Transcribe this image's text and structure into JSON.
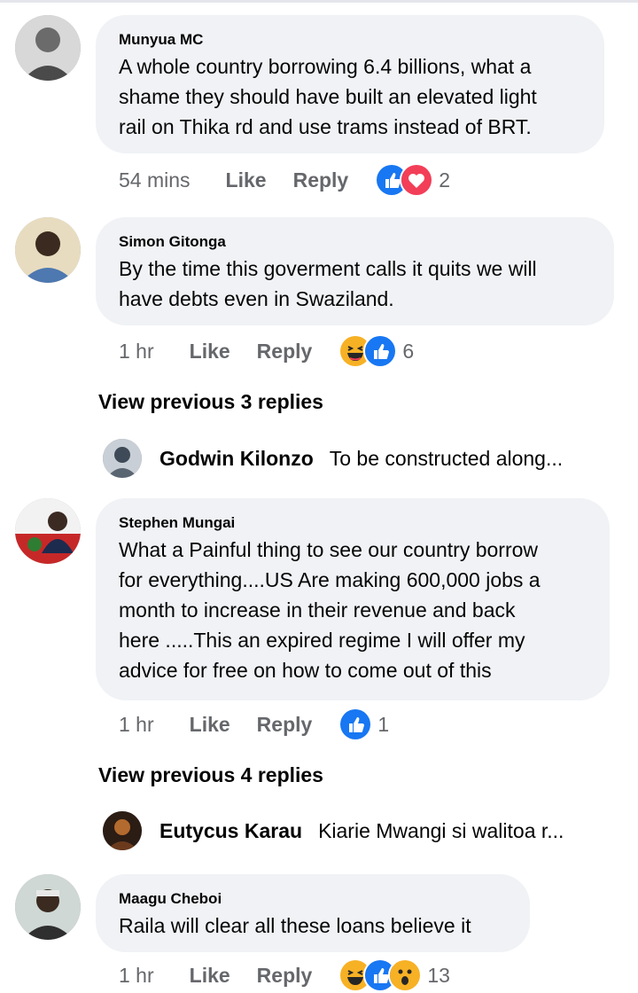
{
  "comments": [
    {
      "author": "Munyua MC",
      "text": "A whole country borrowing 6.4 billions, what a\nshame they should have built an elevated light\nrail on Thika rd and use trams instead of BRT.",
      "time": "54 mins",
      "like": "Like",
      "reply": "Reply",
      "reactions": [
        "like-icon",
        "love-icon"
      ],
      "reaction_count": "2"
    },
    {
      "author": "Simon Gitonga",
      "text": "By the time this goverment calls it quits we will\nhave debts even in Swaziland.",
      "time": "1 hr",
      "like": "Like",
      "reply": "Reply",
      "reactions": [
        "haha-icon",
        "like-icon"
      ],
      "reaction_count": "6"
    },
    {
      "author": "Stephen Mungai",
      "text": "What a Painful thing to see our country borrow\nfor everything....US Are making 600,000 jobs a\nmonth to increase in their revenue and back\nhere .....This an expired regime I will offer my\nadvice for free on how to come out of this",
      "time": "1 hr",
      "like": "Like",
      "reply": "Reply",
      "reactions": [
        "like-icon"
      ],
      "reaction_count": "1"
    },
    {
      "author": "Maagu Cheboi",
      "text": "Raila will clear all these loans believe it",
      "time": "1 hr",
      "like": "Like",
      "reply": "Reply",
      "reactions": [
        "haha-icon",
        "like-icon",
        "wow-icon"
      ],
      "reaction_count": "13"
    }
  ],
  "view_previous": [
    {
      "label": "View previous 3 replies"
    },
    {
      "label": "View previous 4 replies"
    }
  ],
  "reply_previews": [
    {
      "name": "Godwin Kilonzo",
      "text": "To be constructed along..."
    },
    {
      "name": "Eutycus Karau",
      "text": "Kiarie Mwangi si walitoa r..."
    }
  ],
  "colors": {
    "bubble": "#f0f2f5",
    "meta_text": "#65676b",
    "like_blue": "#1877f2",
    "love_red": "#f33e58",
    "haha_yellow": "#f7b125"
  }
}
